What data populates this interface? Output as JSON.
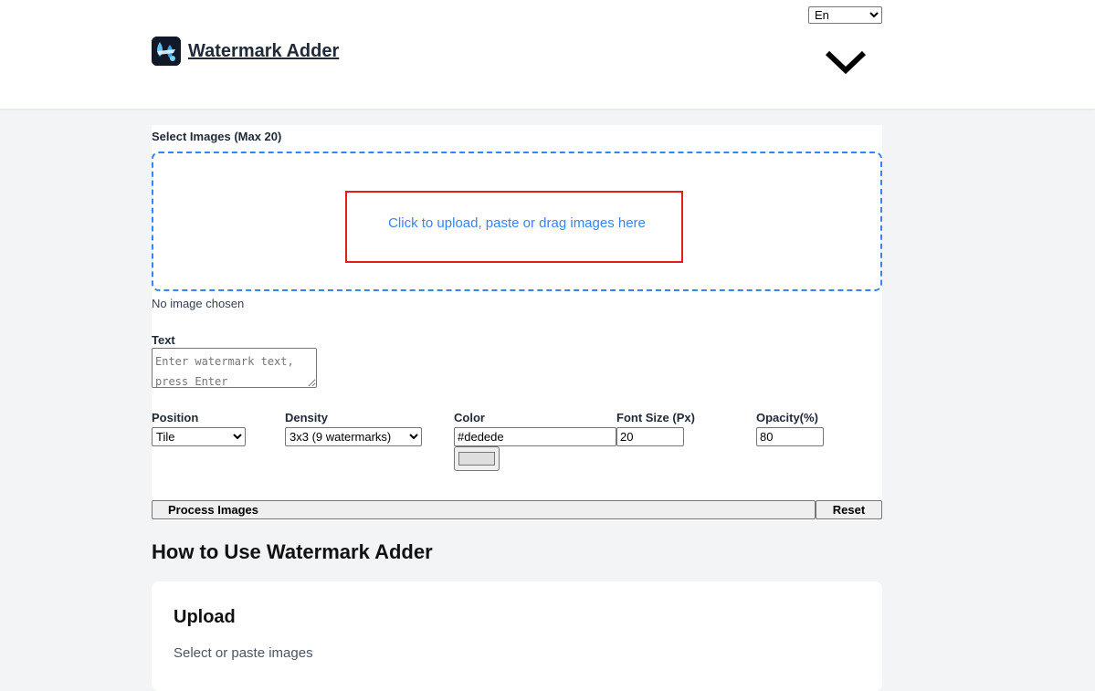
{
  "header": {
    "brand": "Watermark Adder",
    "language": {
      "selected": "En",
      "options": [
        "En"
      ]
    }
  },
  "tool": {
    "select_label": "Select Images (Max 20)",
    "dropzone_text": "Click to upload, paste or drag images here",
    "no_image_text": "No image chosen",
    "text_label": "Text",
    "text_placeholder": "Enter watermark text, press Enter",
    "text_value": "",
    "position": {
      "label": "Position",
      "selected": "Tile"
    },
    "density": {
      "label": "Density",
      "selected": "3x3 (9 watermarks)"
    },
    "color": {
      "label": "Color",
      "value": "#dedede"
    },
    "font_size": {
      "label": "Font Size (Px)",
      "value": "20"
    },
    "opacity": {
      "label": "Opacity(%)",
      "value": "80"
    },
    "process_label": "Process Images",
    "reset_label": "Reset"
  },
  "howto": {
    "title": "How to Use Watermark Adder",
    "steps": [
      {
        "title": "Upload",
        "desc": "Select or paste images"
      }
    ]
  },
  "colors": {
    "accent": "#3b82f6",
    "highlight": "#e11d1d",
    "swatch": "#dedede",
    "logo_bg": "#111827"
  },
  "icons": [
    "app-logo-icon",
    "chevron-down-icon"
  ]
}
